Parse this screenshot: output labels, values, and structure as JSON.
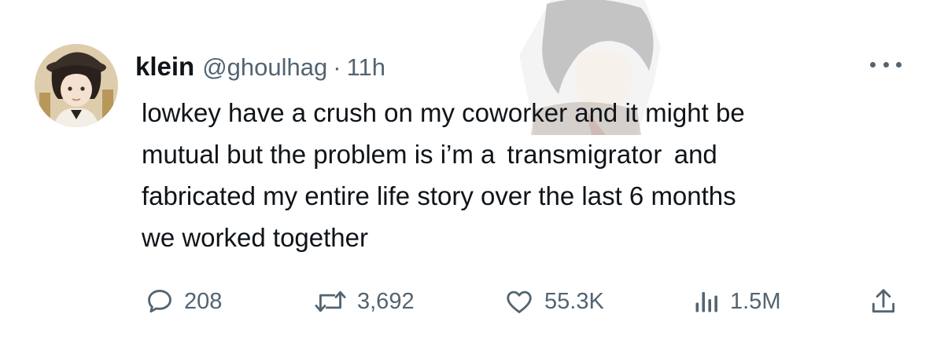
{
  "tweet": {
    "author": {
      "display_name": "klein",
      "handle": "@ghoulhag",
      "separator": "·",
      "timestamp": "11h"
    },
    "text_lines": [
      "lowkey have a crush on my coworker and it might be",
      "mutual but the problem is i’m a",
      "transmigrator",
      "and",
      "fabricated my entire life story over the last 6 months",
      "we worked together"
    ],
    "metrics": {
      "replies": "208",
      "retweets": "3,692",
      "likes": "55.3K",
      "views": "1.5M"
    },
    "icons": {
      "reply": "reply-bubble-icon",
      "retweet": "retweet-arrows-icon",
      "like": "heart-icon",
      "views": "bar-chart-icon",
      "share": "share-upload-icon",
      "more": "more-horizontal-icon"
    },
    "colors": {
      "text_primary": "#0f1419",
      "text_secondary": "#536471",
      "background": "#ffffff"
    }
  }
}
